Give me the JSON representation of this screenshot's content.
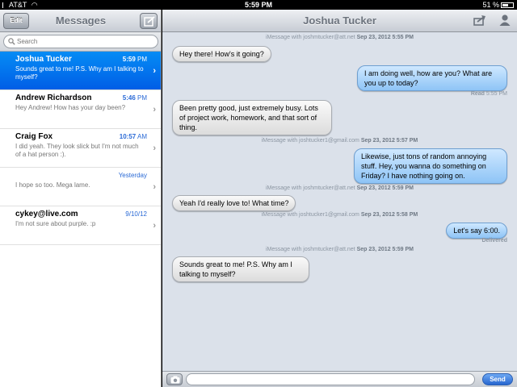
{
  "status_bar": {
    "carrier": "AT&T",
    "time": "5:59 PM",
    "battery": "51 %"
  },
  "sidebar": {
    "title": "Messages",
    "edit_label": "Edit",
    "search_placeholder": "Search",
    "conversations": [
      {
        "name": "Joshua Tucker",
        "time": "5:59",
        "ampm": "PM",
        "preview": "Sounds great to me! P.S. Why am I talking to myself?"
      },
      {
        "name": "Andrew Richardson",
        "time": "5:46",
        "ampm": "PM",
        "preview": "Hey Andrew! How has your day been?"
      },
      {
        "name": "Craig Fox",
        "time": "10:57",
        "ampm": "AM",
        "preview": "I did yeah. They look slick but I'm not much of a hat person :)."
      },
      {
        "name": "",
        "time": "Yesterday",
        "ampm": "",
        "preview": "I hope so too. Mega lame."
      },
      {
        "name": "cykey@live.com",
        "time": "9/10/12",
        "ampm": "",
        "preview": "I'm not sure about purple. :p"
      }
    ]
  },
  "thread": {
    "title": "Joshua Tucker",
    "stamps": [
      {
        "via": "iMessage with joshmtucker@att.net",
        "date": "Sep 23, 2012 5:55 PM"
      },
      {
        "via": "iMessage with joshtucker1@gmail.com",
        "date": "Sep 23, 2012 5:57 PM"
      },
      {
        "via": "iMessage with joshmtucker@att.net",
        "date": "Sep 23, 2012 5:59 PM"
      },
      {
        "via": "iMessage with joshtucker1@gmail.com",
        "date": "Sep 23, 2012 5:58 PM"
      },
      {
        "via": "iMessage with joshmtucker@att.net",
        "date": "Sep 23, 2012 5:59 PM"
      }
    ],
    "messages": [
      "Hey there! How's it going?",
      "I am doing well, how are you? What are you up to today?",
      "Been pretty good, just extremely busy. Lots of project work, homework, and that sort of thing.",
      "Likewise, just tons of random annoying stuff. Hey, you wanna do something on Friday? I have nothing going on.",
      "Yeah I'd really love to! What time?",
      "Let's say 6:00.",
      "Sounds great to me! P.S. Why am I talking to myself?"
    ],
    "read_label": "Read",
    "read_time": "5:55 PM",
    "delivered_label": "Delivered"
  },
  "composer": {
    "send_label": "Send"
  },
  "colors": {
    "selected_row": "#0474ee",
    "outgoing_bubble": "#8ec4f6",
    "incoming_bubble": "#e8e8e8",
    "background": "#dbe1ea"
  }
}
